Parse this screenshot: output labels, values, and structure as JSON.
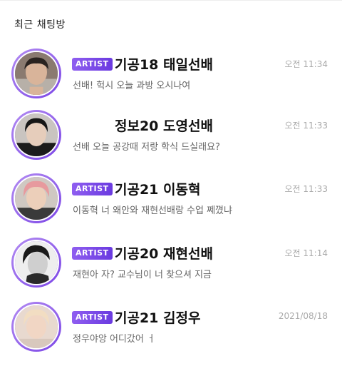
{
  "section_title": "최근 채팅방",
  "colors": {
    "ring_start": "#b38cf2",
    "ring_end": "#7b45e6",
    "badge": "#7b45e6"
  },
  "chats": [
    {
      "badge": "ARTIST",
      "name": "기공18 태일선배",
      "time": "오전 11:34",
      "preview": "선배! 헉시 오늘 과방 오시나여",
      "avatar_icon": "profile-photo"
    },
    {
      "badge": "",
      "name": "정보20 도영선배",
      "time": "오전 11:33",
      "preview": "선배 오늘 공강때 저랑 학식 드실래요?",
      "avatar_icon": "profile-photo"
    },
    {
      "badge": "ARTIST",
      "name": "기공21 이동혁",
      "time": "오전 11:33",
      "preview": "이동혁 너 왜안와 재현선배랑 수업 쩨꼈냐",
      "avatar_icon": "profile-photo"
    },
    {
      "badge": "ARTIST",
      "name": "기공20 재현선배",
      "time": "오전 11:14",
      "preview": "재현아 자? 교수님이 너 찾으셔 지금",
      "avatar_icon": "profile-photo"
    },
    {
      "badge": "ARTIST",
      "name": "기공21 김정우",
      "time": "2021/08/18",
      "preview": "정우야앙 어디갔어 ㅓ",
      "avatar_icon": "profile-photo"
    }
  ]
}
